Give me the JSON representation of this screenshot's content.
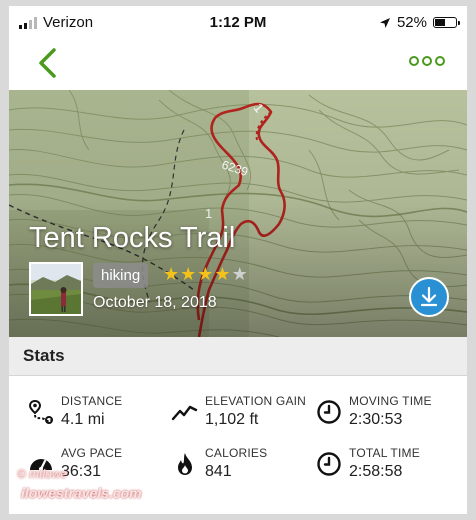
{
  "status_bar": {
    "carrier": "Verizon",
    "time": "1:12 PM",
    "battery": "52%",
    "battery_level": 0.52
  },
  "nav": {
    "back_icon": "chevron-left-icon",
    "more_icon": "more-options-icon"
  },
  "hero": {
    "title": "Tent Rocks Trail",
    "activity_tag": "hiking",
    "rating": 4,
    "rating_max": 5,
    "date": "October 18, 2018",
    "map_labels": [
      "1",
      "6239",
      "1"
    ]
  },
  "stats": {
    "header": "Stats",
    "items": [
      {
        "icon": "distance-icon",
        "label": "DISTANCE",
        "value": "4.1 mi"
      },
      {
        "icon": "elevation-icon",
        "label": "ELEVATION GAIN",
        "value": "1,102 ft"
      },
      {
        "icon": "clock-icon",
        "label": "MOVING TIME",
        "value": "2:30:53"
      },
      {
        "icon": "pace-gauge-icon",
        "label": "AVG PACE",
        "value": "36:31"
      },
      {
        "icon": "flame-icon",
        "label": "CALORIES",
        "value": "841"
      },
      {
        "icon": "clock-icon",
        "label": "TOTAL TIME",
        "value": "2:58:58"
      }
    ]
  },
  "watermark": {
    "line1": "© mtlowe",
    "line2": "ilowestravels.com"
  },
  "colors": {
    "accent_green": "#4a9a1e",
    "download_blue": "#2a90d4",
    "track_red": "#b3241f",
    "star_gold": "#f4c21a"
  }
}
